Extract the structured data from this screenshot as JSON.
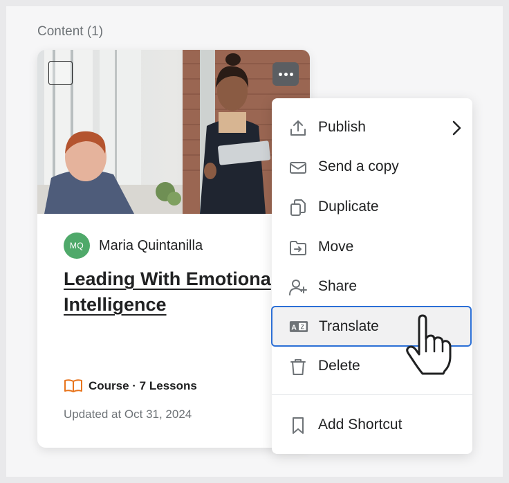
{
  "section": {
    "title": "Content (1)"
  },
  "card": {
    "author_initials": "MQ",
    "author_name": "Maria Quintanilla",
    "title_line1": "Leading With Emotiona",
    "title_line2": "Intelligence",
    "meta": "Course · 7 Lessons",
    "updated": "Updated at Oct 31, 2024"
  },
  "menu": {
    "items": [
      {
        "label": "Publish",
        "icon": "upload-icon",
        "has_submenu": true
      },
      {
        "label": "Send a copy",
        "icon": "envelope-icon"
      },
      {
        "label": "Duplicate",
        "icon": "copy-icon"
      },
      {
        "label": "Move",
        "icon": "folder-move-icon"
      },
      {
        "label": "Share",
        "icon": "user-add-icon"
      },
      {
        "label": "Translate",
        "icon": "translate-icon",
        "highlighted": true
      },
      {
        "label": "Delete",
        "icon": "trash-icon"
      },
      {
        "label": "Add Shortcut",
        "icon": "bookmark-icon"
      }
    ]
  },
  "colors": {
    "accent_blue": "#2b6fd6",
    "avatar_green": "#4fa96a",
    "book_orange": "#e8741c"
  }
}
